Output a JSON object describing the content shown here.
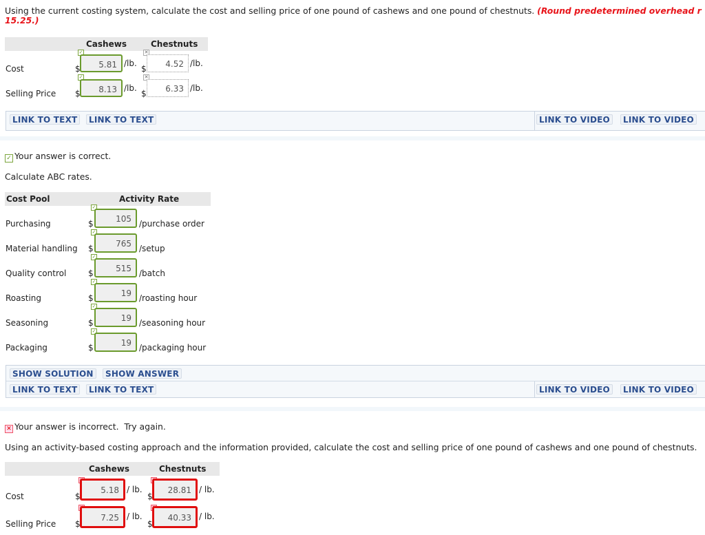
{
  "q1": {
    "prompt": "Using the current costing system, calculate the cost and selling price of one pound of cashews and one pound of chestnuts.",
    "note_line1": "(Round predetermined overhead r",
    "note_line2": "15.25.)",
    "columns": [
      "Cashews",
      "Chestnuts"
    ],
    "rows": [
      {
        "label": "Cost",
        "currency": "$",
        "cashews": "5.81",
        "cashews_unit": "/lb.",
        "chestnuts": "4.52",
        "chestnuts_unit": "/lb."
      },
      {
        "label": "Selling Price",
        "currency": "$",
        "cashews": "8.13",
        "cashews_unit": "/lb.",
        "chestnuts": "6.33",
        "chestnuts_unit": "/lb."
      }
    ],
    "links": [
      "LINK TO TEXT",
      "LINK TO TEXT"
    ],
    "video_links": [
      "LINK TO VIDEO",
      "LINK TO VIDEO"
    ]
  },
  "q2": {
    "status": "Your answer is correct.",
    "prompt": "Calculate ABC rates.",
    "col_pool": "Cost Pool",
    "col_rate": "Activity Rate",
    "rows": [
      {
        "pool": "Purchasing",
        "currency": "$",
        "rate": "105",
        "unit": "/purchase order"
      },
      {
        "pool": "Material handling",
        "currency": "$",
        "rate": "765",
        "unit": "/setup"
      },
      {
        "pool": "Quality control",
        "currency": "$",
        "rate": "515",
        "unit": "/batch"
      },
      {
        "pool": "Roasting",
        "currency": "$",
        "rate": "19",
        "unit": "/roasting hour"
      },
      {
        "pool": "Seasoning",
        "currency": "$",
        "rate": "19",
        "unit": "/seasoning hour"
      },
      {
        "pool": "Packaging",
        "currency": "$",
        "rate": "19",
        "unit": "/packaging hour"
      }
    ],
    "solution_buttons": [
      "SHOW SOLUTION",
      "SHOW ANSWER"
    ],
    "links": [
      "LINK TO TEXT",
      "LINK TO TEXT"
    ],
    "video_links": [
      "LINK TO VIDEO",
      "LINK TO VIDEO"
    ]
  },
  "q3": {
    "status": "Your answer is incorrect.  Try again.",
    "prompt": "Using an activity-based costing approach and the information provided, calculate the cost and selling price of one pound of cashews and one pound of chestnuts.",
    "columns": [
      "Cashews",
      "Chestnuts"
    ],
    "rows": [
      {
        "label": "Cost",
        "currency": "$",
        "cashews": "5.18",
        "cashews_unit": "/ lb.",
        "chestnuts": "28.81",
        "chestnuts_unit": "/ lb."
      },
      {
        "label": "Selling Price",
        "currency": "$",
        "cashews": "7.25",
        "cashews_unit": "/ lb.",
        "chestnuts": "40.33",
        "chestnuts_unit": "/ lb."
      }
    ]
  },
  "icons": {
    "check": "✓",
    "cross": "✕"
  },
  "colors": {
    "correct": "#6a9a2c",
    "incorrect": "#e00d0d",
    "link": "#2b4e8f",
    "note": "#e8141a"
  }
}
